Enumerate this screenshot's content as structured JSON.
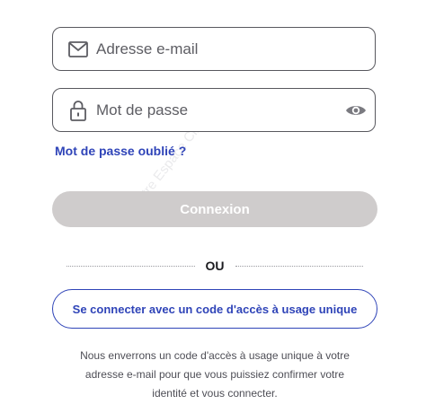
{
  "login_form": {
    "email_placeholder": "Adresse e-mail",
    "password_placeholder": "Mot de passe",
    "forgot_password_label": "Mot de passe oublié ?",
    "login_button_label": "Connexion",
    "separator_label": "OU",
    "otp_button_label": "Se connecter avec un code d'accès à usage unique",
    "info_lines": [
      "Nous enverrons un code d'accès à usage unique à votre",
      "adresse e-mail pour que vous puissiez confirmer votre",
      "identité et vous connecter."
    ]
  },
  "watermark": "Votre Espace Client",
  "icons": {
    "email": "mail-icon",
    "password": "lock-icon",
    "toggle_visibility": "eye-icon"
  },
  "colors": {
    "accent": "#2f44b8",
    "field_border": "#58585e",
    "disabled_button": "#cfcccc",
    "text_muted": "#4e4e56"
  }
}
